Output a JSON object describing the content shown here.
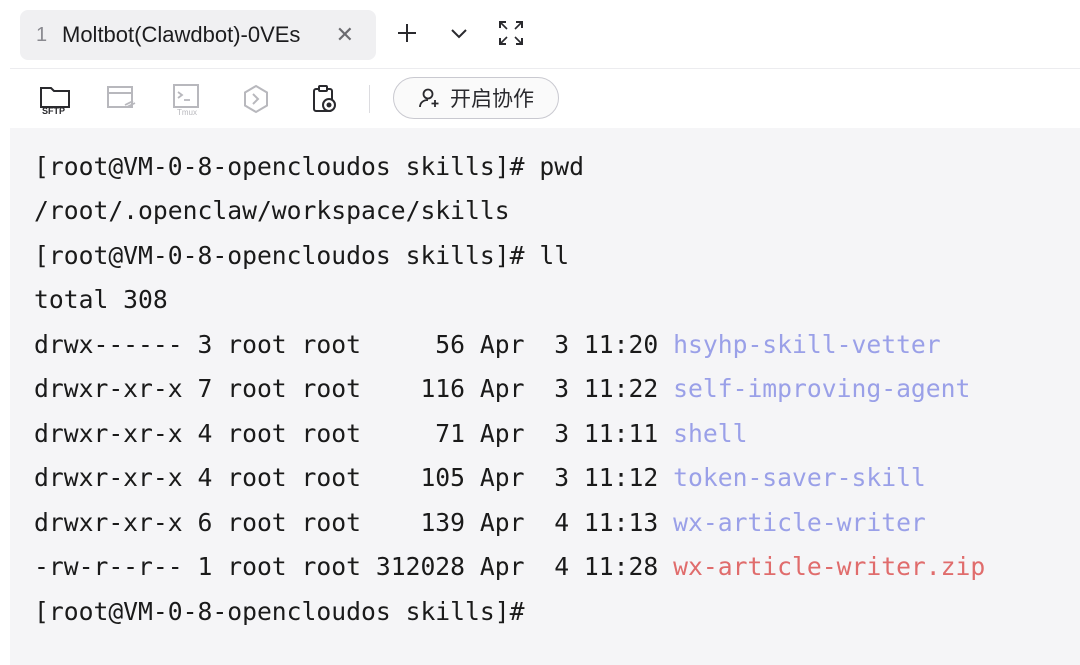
{
  "tab": {
    "index": "1",
    "title": "Moltbot(Clawdbot)-0VEs",
    "close": "✕"
  },
  "tab_actions": {
    "new_tab": "+",
    "more": "⌄",
    "fullscreen": "fullscreen-icon"
  },
  "toolbar": {
    "sftp_label": "SFTP",
    "tmux_label": "Tmux",
    "collab_label": "开启协作"
  },
  "terminal": {
    "lines": [
      {
        "text": "[root@VM-0-8-opencloudos skills]# pwd"
      },
      {
        "text": "/root/.openclaw/workspace/skills"
      },
      {
        "text": "[root@VM-0-8-opencloudos skills]# ll"
      },
      {
        "text": "total 308"
      }
    ],
    "entries": [
      {
        "meta": "drwx------ 3 root root     56 Apr  3 11:20 ",
        "name": "hsyhp-skill-vetter",
        "kind": "dir"
      },
      {
        "meta": "drwxr-xr-x 7 root root    116 Apr  3 11:22 ",
        "name": "self-improving-agent",
        "kind": "dir"
      },
      {
        "meta": "drwxr-xr-x 4 root root     71 Apr  3 11:11 ",
        "name": "shell",
        "kind": "dir"
      },
      {
        "meta": "drwxr-xr-x 4 root root    105 Apr  3 11:12 ",
        "name": "token-saver-skill",
        "kind": "dir"
      },
      {
        "meta": "drwxr-xr-x 6 root root    139 Apr  4 11:13 ",
        "name": "wx-article-writer",
        "kind": "dir"
      },
      {
        "meta": "-rw-r--r-- 1 root root 312028 Apr  4 11:28 ",
        "name": "wx-article-writer.zip",
        "kind": "zip"
      }
    ],
    "prompt": "[root@VM-0-8-opencloudos skills]#"
  },
  "colors": {
    "dir": "#9aa0e8",
    "zip": "#e06c6c",
    "text": "#1a1a1a",
    "terminal_bg": "#f5f5f7"
  }
}
